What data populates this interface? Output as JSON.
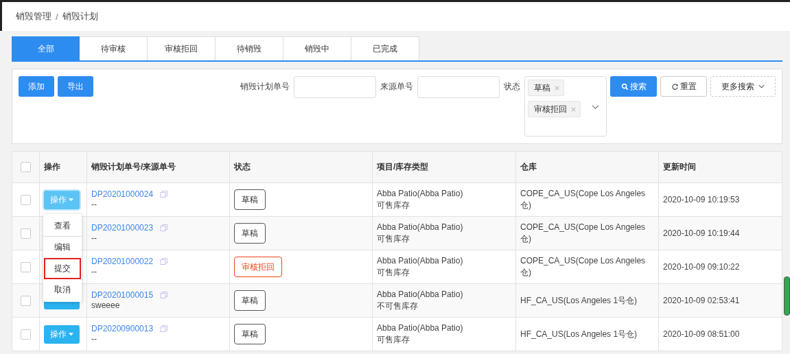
{
  "breadcrumb": [
    "销毁管理",
    "/",
    "销毁计划"
  ],
  "tabs": [
    {
      "label": "全部",
      "selected": true
    },
    {
      "label": "待审核",
      "selected": false
    },
    {
      "label": "审核拒回",
      "selected": false
    },
    {
      "label": "待销毁",
      "selected": false
    },
    {
      "label": "销毁中",
      "selected": false
    },
    {
      "label": "已完成",
      "selected": false
    }
  ],
  "toolbar": {
    "buttons": [
      "添加",
      "导出"
    ]
  },
  "filters": {
    "plan_no_label": "销毁计划单号",
    "source_no_label": "来源单号",
    "status_label": "状态",
    "status_tags": [
      "草稿",
      "审核拒回"
    ],
    "search_button": "搜索",
    "reset_button": "重置",
    "more_button": "更多搜索"
  },
  "table": {
    "columns": [
      "操作",
      "销毁计划单号/来源单号",
      "状态",
      "项目/库存类型",
      "仓库",
      "更新时间"
    ],
    "header_checked": false,
    "rows": [
      {
        "checked": false,
        "action_button": {
          "label": "操作",
          "open": true
        },
        "plan_no": "DP20201000024",
        "source_no": "--",
        "status": {
          "label": "草稿",
          "kind": "draft"
        },
        "project": "Abba Patio(Abba Patio)",
        "stock_type": "可售库存",
        "warehouse": "COPE_CA_US(Cope Los Angeles 仓)",
        "updated": "2020-10-09 10:19:53"
      },
      {
        "checked": false,
        "plan_no": "DP20201000023",
        "source_no": "--",
        "status": {
          "label": "草稿",
          "kind": "draft"
        },
        "project": "Abba Patio(Abba Patio)",
        "stock_type": "可售库存",
        "warehouse": "COPE_CA_US(Cope Los Angeles 仓)",
        "updated": "2020-10-09 10:19:44"
      },
      {
        "checked": false,
        "plan_no": "DP20201000022",
        "source_no": "--",
        "status": {
          "label": "审核拒回",
          "kind": "rejected"
        },
        "project": "Abba Patio(Abba Patio)",
        "stock_type": "可售库存",
        "warehouse": "COPE_CA_US(Cope Los Angeles 仓)",
        "updated": "2020-10-09 09:10:22"
      },
      {
        "checked": false,
        "action_button": {
          "open": false
        },
        "plan_no": "DP20201000015",
        "source_no": "sweeee",
        "status": {
          "label": "草稿",
          "kind": "draft"
        },
        "project": "Abba Patio(Abba Patio)",
        "stock_type": "不可售库存",
        "warehouse": "HF_CA_US(Los Angeles 1号仓)",
        "updated": "2020-10-09 02:53:41"
      },
      {
        "checked": false,
        "action_button": {
          "label": "操作",
          "open": false
        },
        "plan_no": "DP20200900013",
        "source_no": "--",
        "status": {
          "label": "草稿",
          "kind": "draft"
        },
        "project": "Abba Patio(Abba Patio)",
        "stock_type": "可售库存",
        "warehouse": "HF_CA_US(Los Angeles 1号仓)",
        "updated": "2020-10-09 08:51:00"
      }
    ]
  },
  "action_menu": [
    {
      "label": "查看",
      "highlighted": false
    },
    {
      "label": "编辑",
      "highlighted": false
    },
    {
      "label": "提交",
      "highlighted": true
    },
    {
      "label": "取消",
      "highlighted": false
    }
  ]
}
